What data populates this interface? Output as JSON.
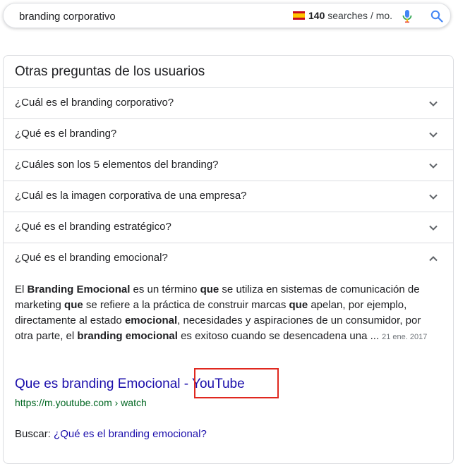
{
  "search": {
    "query": "branding corporativo",
    "volume_count": "140",
    "volume_suffix": " searches / mo.",
    "flag": "spain-flag"
  },
  "paa": {
    "title": "Otras preguntas de los usuarios",
    "questions": [
      {
        "label": "¿Cuál es el branding corporativo?",
        "expanded": false
      },
      {
        "label": "¿Qué es el branding?",
        "expanded": false
      },
      {
        "label": "¿Cuáles son los 5 elementos del branding?",
        "expanded": false
      },
      {
        "label": "¿Cuál es la imagen corporativa de una empresa?",
        "expanded": false
      },
      {
        "label": "¿Qué es el branding estratégico?",
        "expanded": false
      },
      {
        "label": "¿Qué es el branding emocional?",
        "expanded": true
      }
    ],
    "answer": {
      "parts": [
        {
          "t": "El ",
          "b": false
        },
        {
          "t": "Branding Emocional",
          "b": true
        },
        {
          "t": " es un término ",
          "b": false
        },
        {
          "t": "que",
          "b": true
        },
        {
          "t": " se utiliza en sistemas de comunicación de marketing ",
          "b": false
        },
        {
          "t": "que",
          "b": true
        },
        {
          "t": " se refiere a la práctica de construir marcas ",
          "b": false
        },
        {
          "t": "que",
          "b": true
        },
        {
          "t": " apelan, por ejemplo, directamente al estado ",
          "b": false
        },
        {
          "t": "emocional",
          "b": true
        },
        {
          "t": ", necesidades y aspiraciones de un consumidor, por otra parte, el ",
          "b": false
        },
        {
          "t": "branding emocional",
          "b": true
        },
        {
          "t": " es exitoso cuando se desencadena una ...",
          "b": false
        }
      ],
      "date": "21 ene. 2017"
    },
    "result": {
      "title": "Que es branding Emocional - YouTube",
      "url": "https://m.youtube.com › watch"
    },
    "buscar": {
      "label": "Buscar: ",
      "link": "¿Qué es el branding emocional?"
    }
  },
  "colors": {
    "link": "#1a0dab",
    "url_green": "#006621",
    "highlight": "#e0281f",
    "icon_gray": "#5f6368"
  }
}
